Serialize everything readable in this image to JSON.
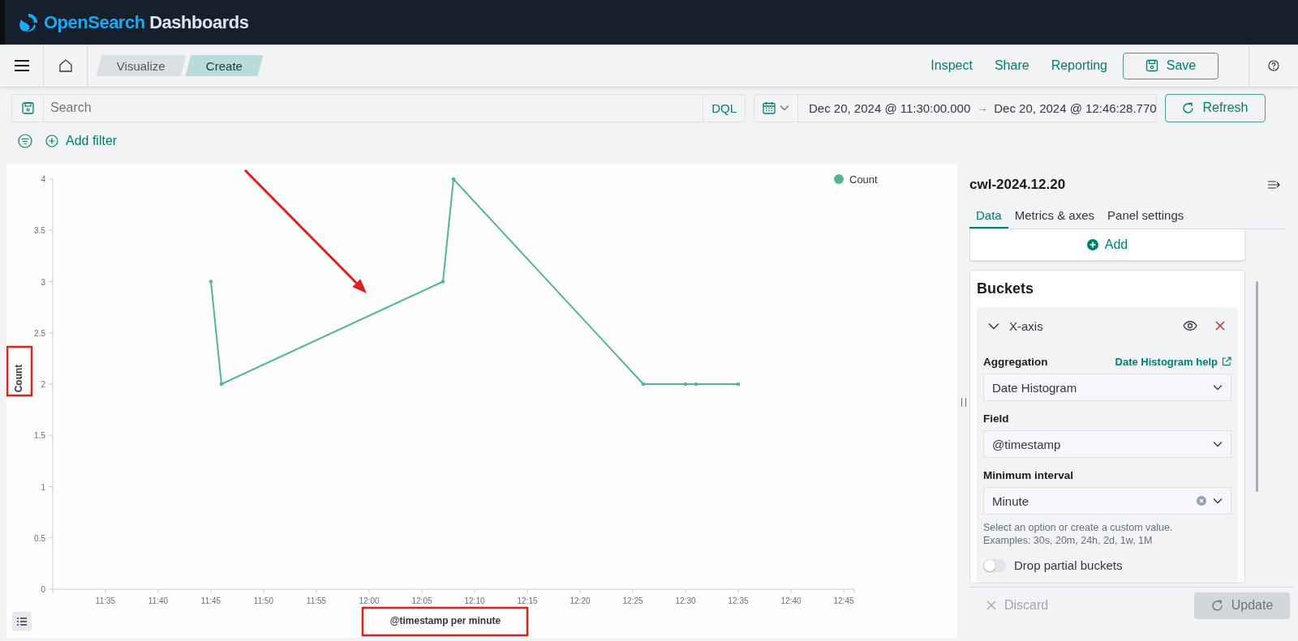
{
  "header": {
    "brand": [
      "OpenSearch",
      "Dashboards"
    ]
  },
  "nav": {
    "breadcrumbs": [
      {
        "label": "Visualize",
        "selected": false
      },
      {
        "label": "Create",
        "selected": true
      }
    ],
    "links": [
      "Inspect",
      "Share",
      "Reporting"
    ],
    "save_button": "Save"
  },
  "query_bar": {
    "placeholder": "Search",
    "language": "DQL",
    "time_start": "Dec 20, 2024 @ 11:30:00.000",
    "time_arrow": "→",
    "time_end": "Dec 20, 2024 @ 12:46:28.770",
    "refresh_button": "Refresh"
  },
  "filter_bar": {
    "add_filter": "Add filter"
  },
  "chart": {
    "ylabel_highlighted": true,
    "xlabel_highlighted": true,
    "chart_data": {
      "type": "line",
      "xlabel": "@timestamp per minute",
      "ylabel": "Count",
      "x": [
        705,
        706,
        727,
        728,
        746,
        750,
        751,
        755
      ],
      "series": [
        {
          "name": "Count",
          "color": "#54b399",
          "values": [
            3,
            2,
            3,
            4,
            2,
            2,
            2,
            2
          ]
        }
      ],
      "xlim": [
        690,
        766
      ],
      "ylim": [
        0,
        4
      ],
      "xticks": [
        {
          "value": 695,
          "label": "11:35"
        },
        {
          "value": 700,
          "label": "11:40"
        },
        {
          "value": 705,
          "label": "11:45"
        },
        {
          "value": 710,
          "label": "11:50"
        },
        {
          "value": 715,
          "label": "11:55"
        },
        {
          "value": 720,
          "label": "12:00"
        },
        {
          "value": 725,
          "label": "12:05"
        },
        {
          "value": 730,
          "label": "12:10"
        },
        {
          "value": 735,
          "label": "12:15"
        },
        {
          "value": 740,
          "label": "12:20"
        },
        {
          "value": 745,
          "label": "12:25"
        },
        {
          "value": 750,
          "label": "12:30"
        },
        {
          "value": 755,
          "label": "12:35"
        },
        {
          "value": 760,
          "label": "12:40"
        },
        {
          "value": 765,
          "label": "12:45"
        }
      ],
      "yticks": [
        0,
        0.5,
        1,
        1.5,
        2,
        2.5,
        3,
        3.5,
        4
      ]
    },
    "arrow_shown": true
  },
  "editor": {
    "index_title": "cwl-2024.12.20",
    "tabs": [
      {
        "label": "Data",
        "selected": true
      },
      {
        "label": "Metrics & axes",
        "selected": false
      },
      {
        "label": "Panel settings",
        "selected": false
      }
    ],
    "add_button": "Add",
    "buckets_title": "Buckets",
    "bucket": {
      "label": "X-axis",
      "expanded": true,
      "aggregation_label": "Aggregation",
      "help_link": "Date Histogram help",
      "aggregation_value": "Date Histogram",
      "field_label": "Field",
      "field_value": "@timestamp",
      "interval_label": "Minimum interval",
      "interval_value": "Minute",
      "help_lines": [
        "Select an option or create a custom value.",
        "Examples: 30s, 20m, 24h, 2d, 1w, 1M"
      ],
      "toggle": {
        "label": "Drop partial buckets",
        "on": false
      }
    },
    "discard_button": "Discard",
    "update_button": {
      "label": "Update",
      "disabled": true
    }
  }
}
